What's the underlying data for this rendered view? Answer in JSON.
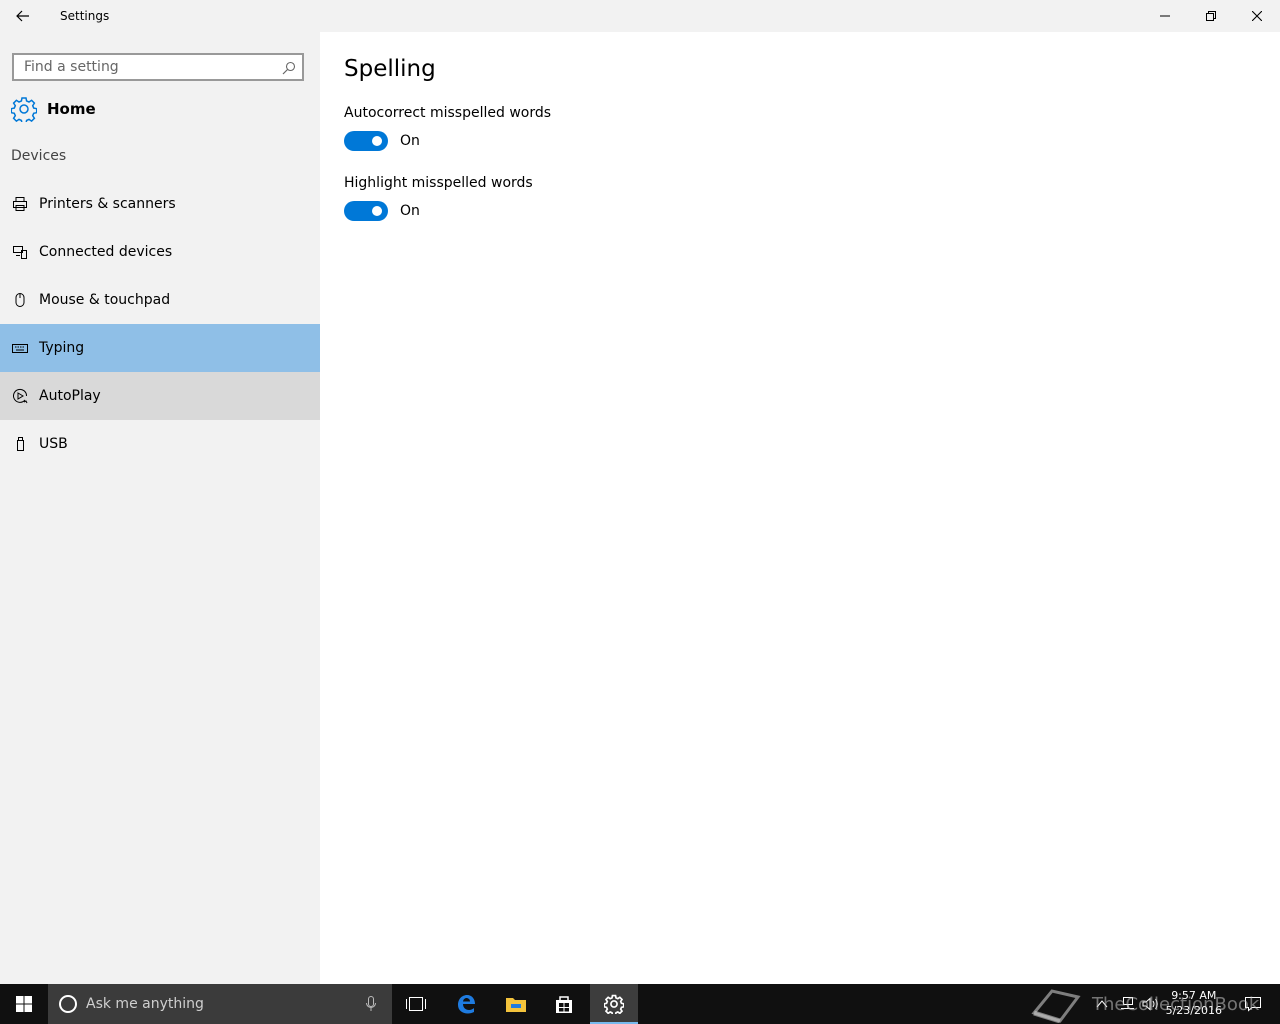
{
  "window": {
    "title": "Settings"
  },
  "sidebar": {
    "search_placeholder": "Find a setting",
    "home_label": "Home",
    "section_label": "Devices",
    "items": [
      {
        "label": "Printers & scanners",
        "icon": "printer-icon"
      },
      {
        "label": "Connected devices",
        "icon": "connected-devices-icon"
      },
      {
        "label": "Mouse & touchpad",
        "icon": "mouse-icon"
      },
      {
        "label": "Typing",
        "icon": "keyboard-icon",
        "selected": true
      },
      {
        "label": "AutoPlay",
        "icon": "autoplay-icon"
      },
      {
        "label": "USB",
        "icon": "usb-icon"
      }
    ]
  },
  "main": {
    "title": "Spelling",
    "settings": [
      {
        "label": "Autocorrect misspelled words",
        "state": "On"
      },
      {
        "label": "Highlight misspelled words",
        "state": "On"
      }
    ]
  },
  "taskbar": {
    "search_placeholder": "Ask me anything",
    "time": "9:57 AM",
    "date": "5/23/2016"
  },
  "watermark": "TheCollectionBook",
  "colors": {
    "accent": "#0078d7",
    "selected_bg": "#8fbfe7",
    "hover_bg": "#d9d9d9",
    "sidebar_bg": "#f2f2f2"
  }
}
